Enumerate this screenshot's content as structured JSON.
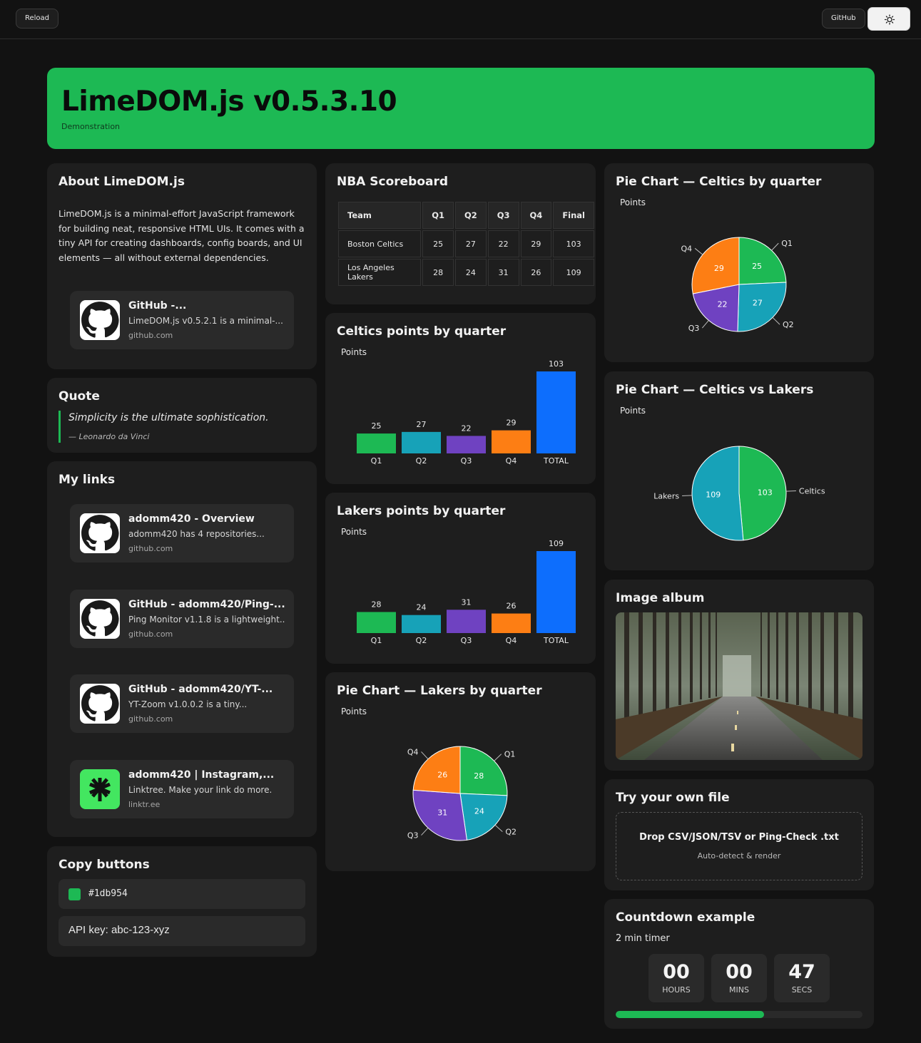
{
  "topbar": {
    "reload_label": "Reload",
    "github_label": "GitHub",
    "theme_icon": "sun-icon"
  },
  "hero": {
    "title": "LimeDOM.js v0.5.3.10",
    "subtitle": "Demonstration"
  },
  "about": {
    "title": "About LimeDOM.js",
    "text": "LimeDOM.js is a minimal-effort JavaScript framework for building neat, responsive HTML UIs. It comes with a tiny API for creating dashboards, config boards, and UI elements — all without external dependencies.",
    "link": {
      "title": "GitHub -...",
      "desc": "LimeDOM.js v0.5.2.1 is a minimal-...",
      "domain": "github.com",
      "icon": "github-icon"
    }
  },
  "quote": {
    "title": "Quote",
    "text": "Simplicity is the ultimate sophistication.",
    "author": "— Leonardo da Vinci"
  },
  "links": {
    "title": "My links",
    "items": [
      {
        "title": "adomm420 - Overview",
        "desc": "adomm420 has 4 repositories...",
        "domain": "github.com",
        "icon": "github-icon"
      },
      {
        "title": "GitHub - adomm420/Ping-...",
        "desc": "Ping Monitor v1.1.8 is a lightweight...",
        "domain": "github.com",
        "icon": "github-icon"
      },
      {
        "title": "GitHub - adomm420/YT-...",
        "desc": "YT-Zoom v1.0.0.2 is a tiny...",
        "domain": "github.com",
        "icon": "github-icon"
      },
      {
        "title": "adomm420 | Instagram,...",
        "desc": "Linktree. Make your link do more.",
        "domain": "linktr.ee",
        "icon": "linktree-icon"
      }
    ]
  },
  "copy": {
    "title": "Copy buttons",
    "color_value": "#1db954",
    "api_text": "API key: abc-123-xyz"
  },
  "scoreboard": {
    "title": "NBA Scoreboard",
    "headers": [
      "Team",
      "Q1",
      "Q2",
      "Q3",
      "Q4",
      "Final"
    ],
    "rows": [
      [
        "Boston Celtics",
        "25",
        "27",
        "22",
        "29",
        "103"
      ],
      [
        "Los Angeles Lakers",
        "28",
        "24",
        "31",
        "26",
        "109"
      ]
    ]
  },
  "album": {
    "title": "Image album"
  },
  "file": {
    "title": "Try your own file",
    "drop_title": "Drop CSV/JSON/TSV or Ping-Check .txt",
    "drop_sub": "Auto-detect & render"
  },
  "countdown": {
    "title": "Countdown example",
    "subtitle": "2 min timer",
    "hours": "00",
    "hours_label": "HOURS",
    "mins": "00",
    "mins_label": "MINS",
    "secs": "47",
    "secs_label": "SECS",
    "progress": 0.6
  },
  "colors": {
    "accent": "#1db954",
    "q1": "#1db954",
    "q2": "#17a2b8",
    "q3": "#6f42c1",
    "q4": "#fd7e14",
    "total": "#0d6efd"
  },
  "chart_data": [
    {
      "type": "bar",
      "title": "Celtics points by quarter",
      "ylabel": "Points",
      "categories": [
        "Q1",
        "Q2",
        "Q3",
        "Q4",
        "TOTAL"
      ],
      "values": [
        25,
        27,
        22,
        29,
        103
      ]
    },
    {
      "type": "bar",
      "title": "Lakers points by quarter",
      "ylabel": "Points",
      "categories": [
        "Q1",
        "Q2",
        "Q3",
        "Q4",
        "TOTAL"
      ],
      "values": [
        28,
        24,
        31,
        26,
        109
      ]
    },
    {
      "type": "pie",
      "title": "Pie Chart — Lakers by quarter",
      "ylabel": "Points",
      "categories": [
        "Q1",
        "Q2",
        "Q3",
        "Q4"
      ],
      "values": [
        28,
        24,
        31,
        26
      ]
    },
    {
      "type": "pie",
      "title": "Pie Chart — Celtics by quarter",
      "ylabel": "Points",
      "categories": [
        "Q1",
        "Q2",
        "Q3",
        "Q4"
      ],
      "values": [
        25,
        27,
        22,
        29
      ]
    },
    {
      "type": "pie",
      "title": "Pie Chart — Celtics vs Lakers",
      "ylabel": "Points",
      "categories": [
        "Celtics",
        "Lakers"
      ],
      "values": [
        103,
        109
      ]
    }
  ]
}
